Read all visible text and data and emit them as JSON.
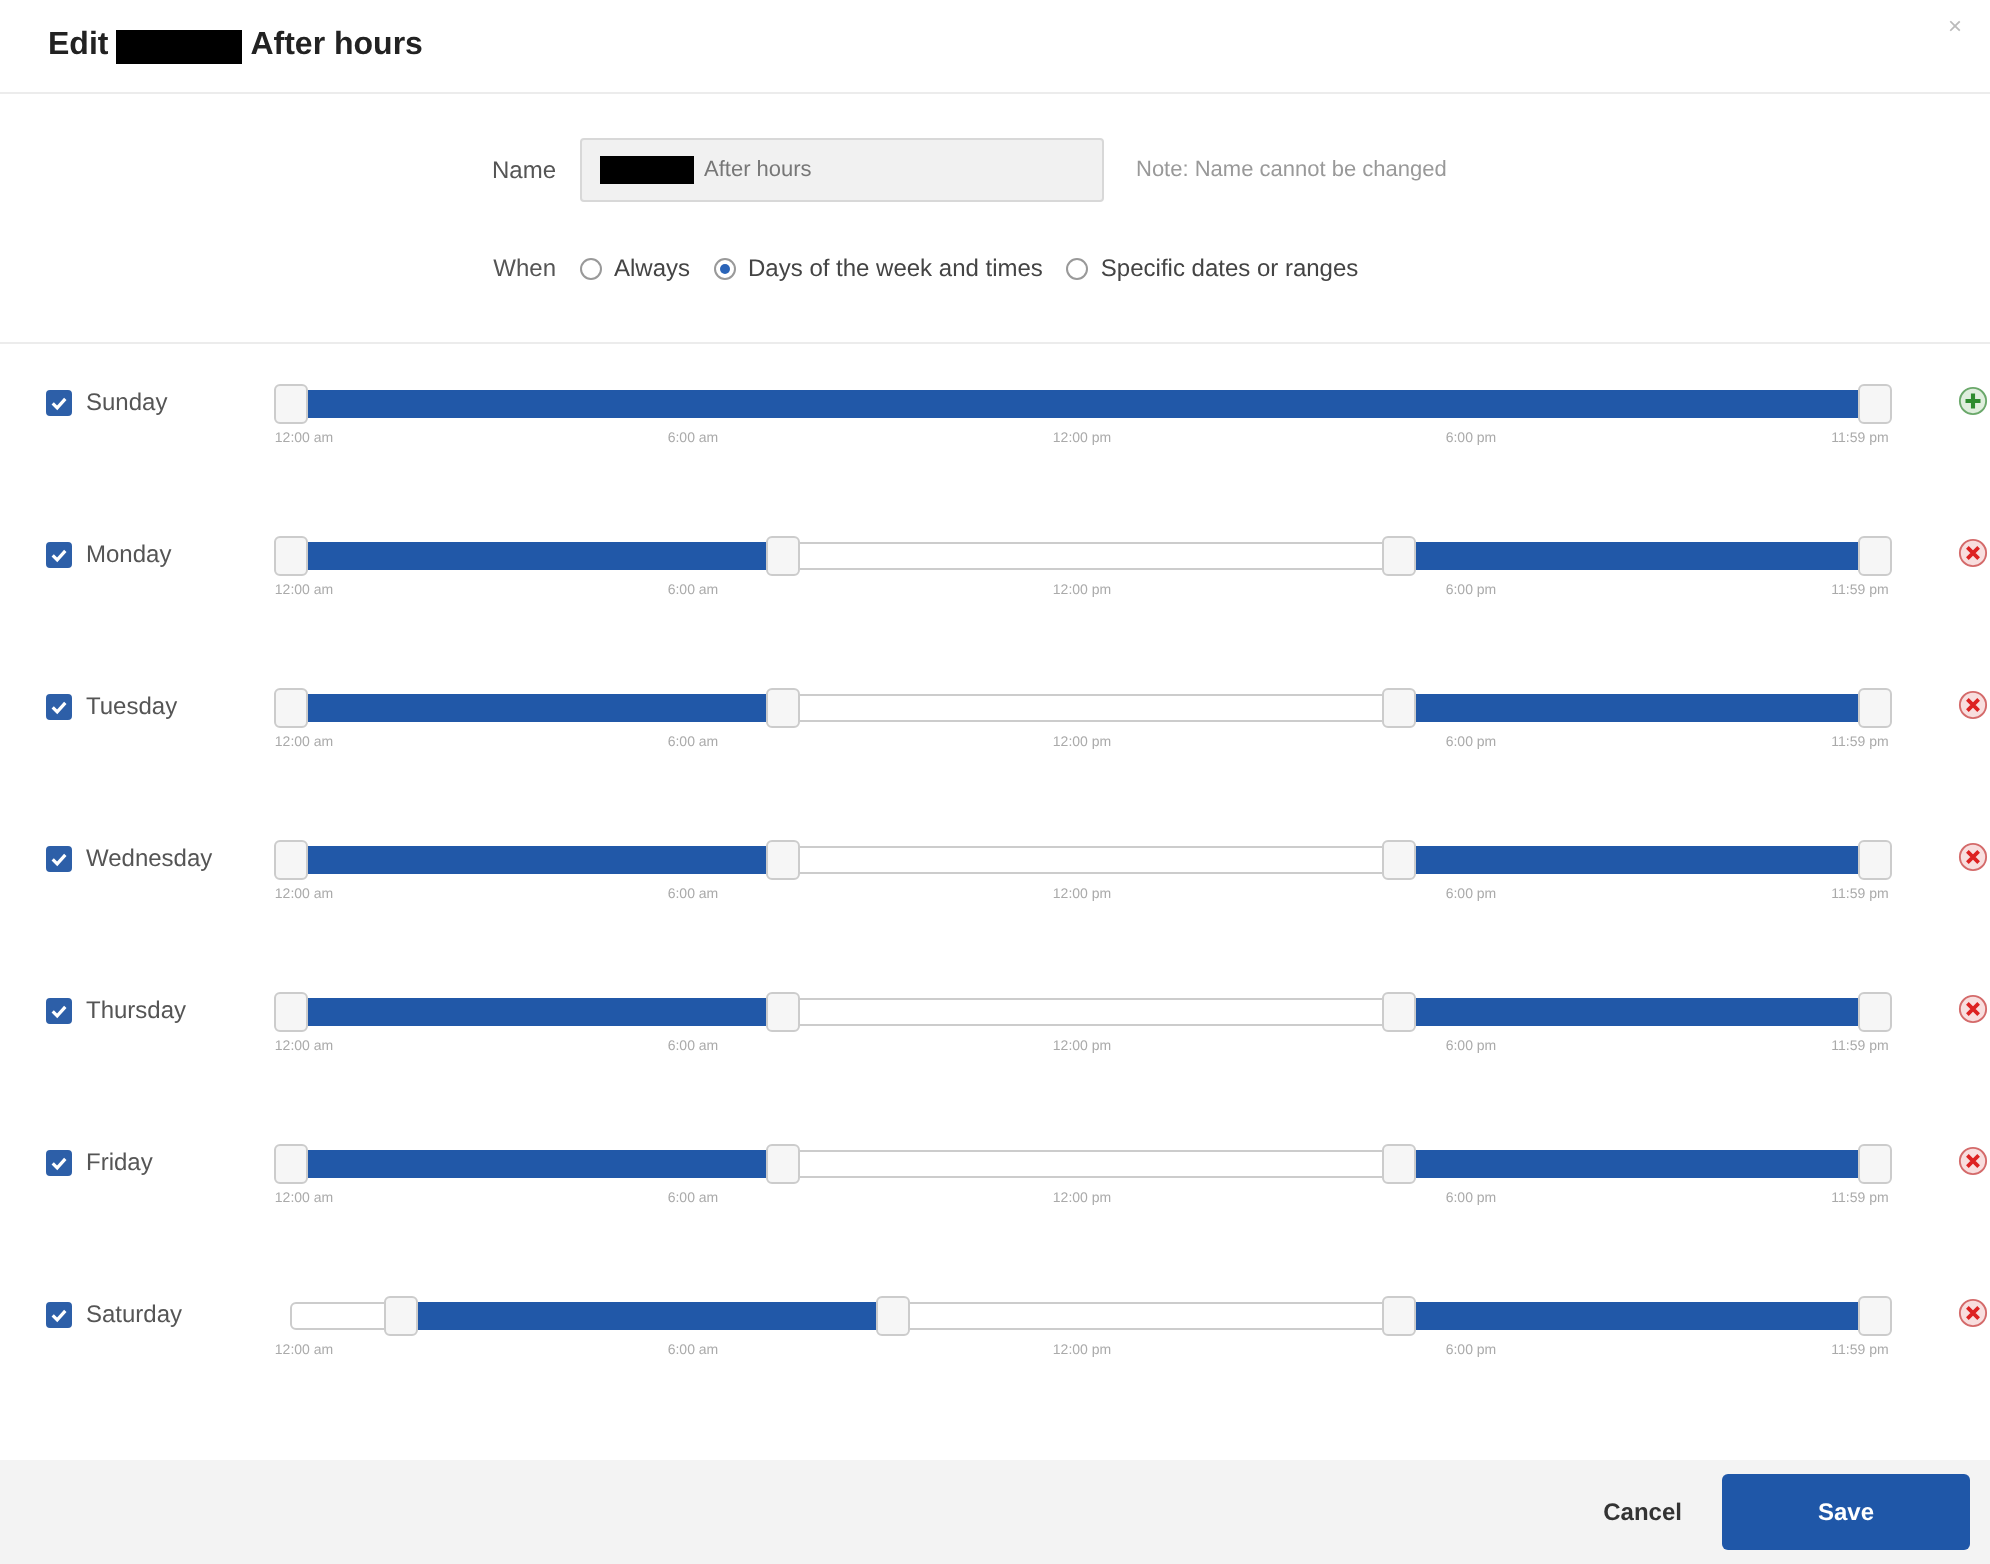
{
  "dialog": {
    "title_start": "Edit",
    "title_end": "After hours",
    "close": "×"
  },
  "name": {
    "label": "Name",
    "value": "After hours",
    "note": "Note: Name cannot be changed"
  },
  "when": {
    "label": "When",
    "options": [
      {
        "label": "Always",
        "selected": false
      },
      {
        "label": "Days of the week and times",
        "selected": true
      },
      {
        "label": "Specific dates or ranges",
        "selected": false
      }
    ]
  },
  "days": [
    {
      "label": "Sunday",
      "checked": true,
      "kind": "add",
      "handles": [
        {
          "level": 0
        },
        {
          "level": 1
        }
      ],
      "ticks": [
        "12:00 am",
        "6:00 am",
        "12:00 pm",
        "6:00 pm",
        "11:59 pm"
      ]
    },
    {
      "label": "Monday",
      "checked": true,
      "kind": "remove",
      "handles": [
        {
          "level": 0
        },
        {
          "level": 0.31
        },
        {
          "level": 0.7
        },
        {
          "level": 1
        }
      ],
      "ticks": [
        "12:00 am",
        "6:00 am",
        "12:00 pm",
        "6:00 pm",
        "11:59 pm"
      ]
    },
    {
      "label": "Tuesday",
      "checked": true,
      "kind": "remove",
      "handles": [
        {
          "level": 0
        },
        {
          "level": 0.31
        },
        {
          "level": 0.7
        },
        {
          "level": 1
        }
      ],
      "ticks": [
        "12:00 am",
        "6:00 am",
        "12:00 pm",
        "6:00 pm",
        "11:59 pm"
      ]
    },
    {
      "label": "Wednesday",
      "checked": true,
      "kind": "remove",
      "handles": [
        {
          "level": 0
        },
        {
          "level": 0.31
        },
        {
          "level": 0.7
        },
        {
          "level": 1
        }
      ],
      "ticks": [
        "12:00 am",
        "6:00 am",
        "12:00 pm",
        "6:00 pm",
        "11:59 pm"
      ]
    },
    {
      "label": "Thursday",
      "checked": true,
      "kind": "remove",
      "handles": [
        {
          "level": 0
        },
        {
          "level": 0.31
        },
        {
          "level": 0.7
        },
        {
          "level": 1
        }
      ],
      "ticks": [
        "12:00 am",
        "6:00 am",
        "12:00 pm",
        "6:00 pm",
        "11:59 pm"
      ]
    },
    {
      "label": "Friday",
      "checked": true,
      "kind": "remove",
      "handles": [
        {
          "level": 0
        },
        {
          "level": 0.31
        },
        {
          "level": 0.7
        },
        {
          "level": 1
        }
      ],
      "ticks": [
        "12:00 am",
        "6:00 am",
        "12:00 pm",
        "6:00 pm",
        "11:59 pm"
      ]
    },
    {
      "label": "Saturday",
      "checked": true,
      "kind": "remove",
      "handles": [
        {
          "level": 0.07
        },
        {
          "level": 0.38
        },
        {
          "level": 0.7
        },
        {
          "level": 1
        }
      ],
      "ticks": [
        "12:00 am",
        "6:00 am",
        "12:00 pm",
        "6:00 pm",
        "11:59 pm"
      ]
    }
  ],
  "buttons": {
    "cancel": "Cancel",
    "save": "Save"
  }
}
